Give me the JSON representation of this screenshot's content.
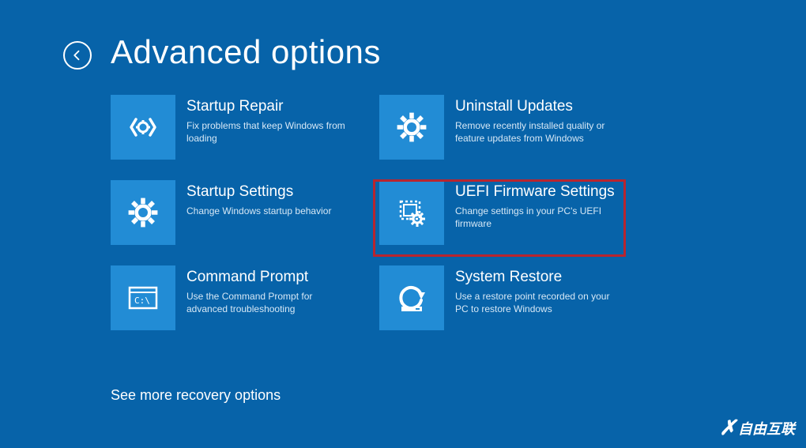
{
  "header": {
    "title": "Advanced options"
  },
  "tiles": {
    "startup_repair": {
      "title": "Startup Repair",
      "desc": "Fix problems that keep Windows from loading"
    },
    "uninstall_updates": {
      "title": "Uninstall Updates",
      "desc": "Remove recently installed quality or feature updates from Windows"
    },
    "startup_settings": {
      "title": "Startup Settings",
      "desc": "Change Windows startup behavior"
    },
    "uefi": {
      "title": "UEFI Firmware Settings",
      "desc": "Change settings in your PC's UEFI firmware"
    },
    "command_prompt": {
      "title": "Command Prompt",
      "desc": "Use the Command Prompt for advanced troubleshooting"
    },
    "system_restore": {
      "title": "System Restore",
      "desc": "Use a restore point recorded on your PC to restore Windows"
    }
  },
  "see_more": "See more recovery options",
  "watermark": "自由互联",
  "highlighted_tile": "uefi"
}
